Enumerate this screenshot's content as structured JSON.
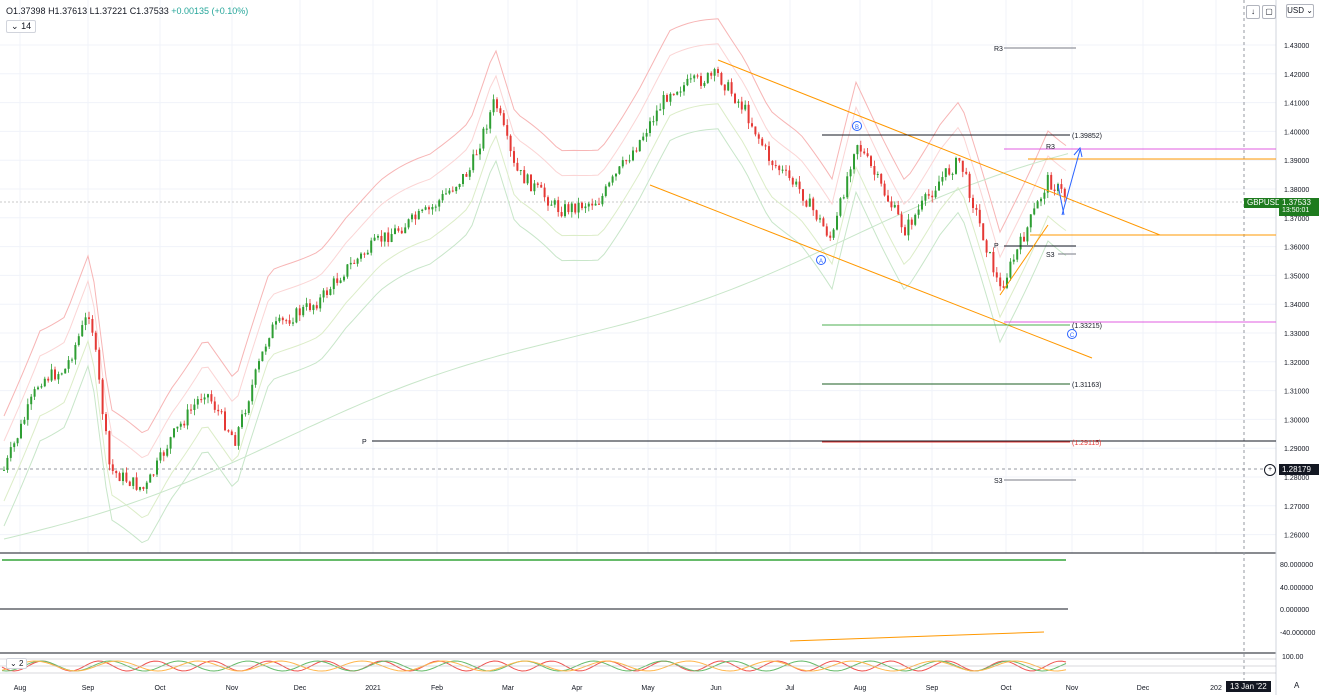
{
  "symbol": "GBPUSD",
  "ohlc": {
    "open": "O1.37398",
    "high": "H1.37613",
    "low": "L1.37221",
    "close": "C1.37533",
    "change": "+0.00135 (+0.10%)"
  },
  "indicator_tag": "14",
  "indicator_tag2": "2",
  "currency": "USD",
  "last_price": "1.37533",
  "countdown": "13:50:01",
  "crosshair_price": "1.28179",
  "crosshair_date": "13 Jan '22",
  "price_axis": [
    "1.43000",
    "1.42000",
    "1.41000",
    "1.40000",
    "1.39000",
    "1.38000",
    "1.37000",
    "1.36000",
    "1.35000",
    "1.34000",
    "1.33000",
    "1.32000",
    "1.31000",
    "1.30000",
    "1.29000",
    "1.28000",
    "1.27000",
    "1.26000"
  ],
  "rsi_axis": [
    "80.000000",
    "40.000000",
    "0.000000",
    "-40.000000"
  ],
  "stoch_axis": [
    "100.00"
  ],
  "time_axis": [
    "Aug",
    "Sep",
    "Oct",
    "Nov",
    "Dec",
    "2021",
    "Feb",
    "Mar",
    "Apr",
    "May",
    "Jun",
    "Jul",
    "Aug",
    "Sep",
    "Oct",
    "Nov",
    "Dec",
    "202"
  ],
  "pivots": {
    "r3_top": "R3",
    "r3_mid": "R3",
    "p_mid": "P",
    "s3_mid": "S3",
    "p_low": "P",
    "s3_low": "S3"
  },
  "level_labels": {
    "l1": "(1.39852)",
    "l2": "(1.33215)",
    "l3": "(1.31163)",
    "l4": "(1.29115)"
  },
  "wave_labels": {
    "a": "A",
    "b": "B",
    "c": "C"
  },
  "colors": {
    "up": "#2e9e33",
    "down": "#e53935",
    "band": "#f7b5b5",
    "channel": "#ff9800",
    "magenta": "#e05ce0",
    "rsi_up": "#66bb6a",
    "rsi_down": "#ef5350"
  }
}
